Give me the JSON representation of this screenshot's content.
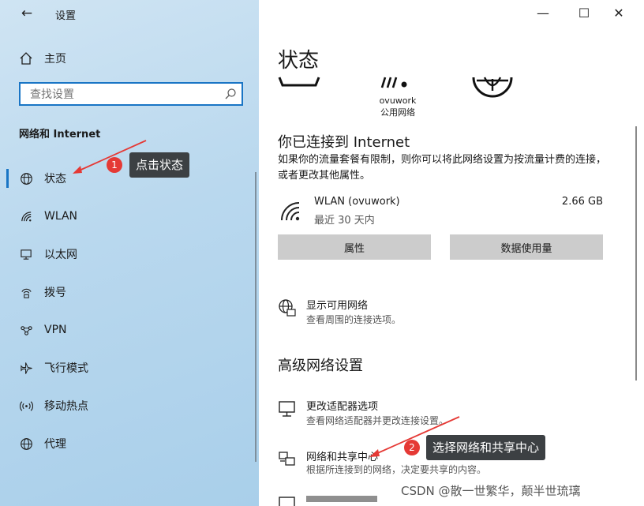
{
  "window": {
    "title": "设置",
    "back_glyph": "←"
  },
  "controls": {
    "minimize": "—",
    "maximize": "☐",
    "close": "✕"
  },
  "sidebar": {
    "home_label": "主页",
    "search_placeholder": "查找设置",
    "section_title": "网络和 Internet",
    "items": [
      {
        "label": "状态",
        "icon": "globe-icon",
        "selected": true
      },
      {
        "label": "WLAN",
        "icon": "wifi-icon"
      },
      {
        "label": "以太网",
        "icon": "ethernet-icon"
      },
      {
        "label": "拨号",
        "icon": "dialup-icon"
      },
      {
        "label": "VPN",
        "icon": "vpn-icon"
      },
      {
        "label": "飞行模式",
        "icon": "airplane-icon"
      },
      {
        "label": "移动热点",
        "icon": "hotspot-icon"
      },
      {
        "label": "代理",
        "icon": "proxy-globe-icon"
      }
    ]
  },
  "annotations": [
    {
      "number": "1",
      "text": "点击状态"
    },
    {
      "number": "2",
      "text": "选择网络和共享中心"
    }
  ],
  "main": {
    "title": "状态",
    "network_name": "ovuwork",
    "network_type": "公用网络",
    "connected_heading": "你已连接到 Internet",
    "connected_desc": "如果你的流量套餐有限制，则你可以将此网络设置为按流量计费的连接，或者更改其他属性。",
    "connection": {
      "name": "WLAN (ovuwork)",
      "sub": "最近 30 天内",
      "size": "2.66 GB"
    },
    "buttons": {
      "properties": "属性",
      "data_usage": "数据使用量"
    },
    "show_networks": {
      "title": "显示可用网络",
      "desc": "查看周围的连接选项。"
    },
    "advanced_heading": "高级网络设置",
    "adapter_options": {
      "title": "更改适配器选项",
      "desc": "查看网络适配器并更改连接设置。"
    },
    "sharing_center": {
      "title": "网络和共享中心",
      "desc": "根据所连接到的网络，决定要共享的内容。"
    }
  },
  "watermark": "CSDN @散一世繁华，颠半世琉璃",
  "colors": {
    "accent": "#1975c5",
    "callout_bg": "#3c4043",
    "badge": "#e53935",
    "arrow": "#e53935"
  }
}
